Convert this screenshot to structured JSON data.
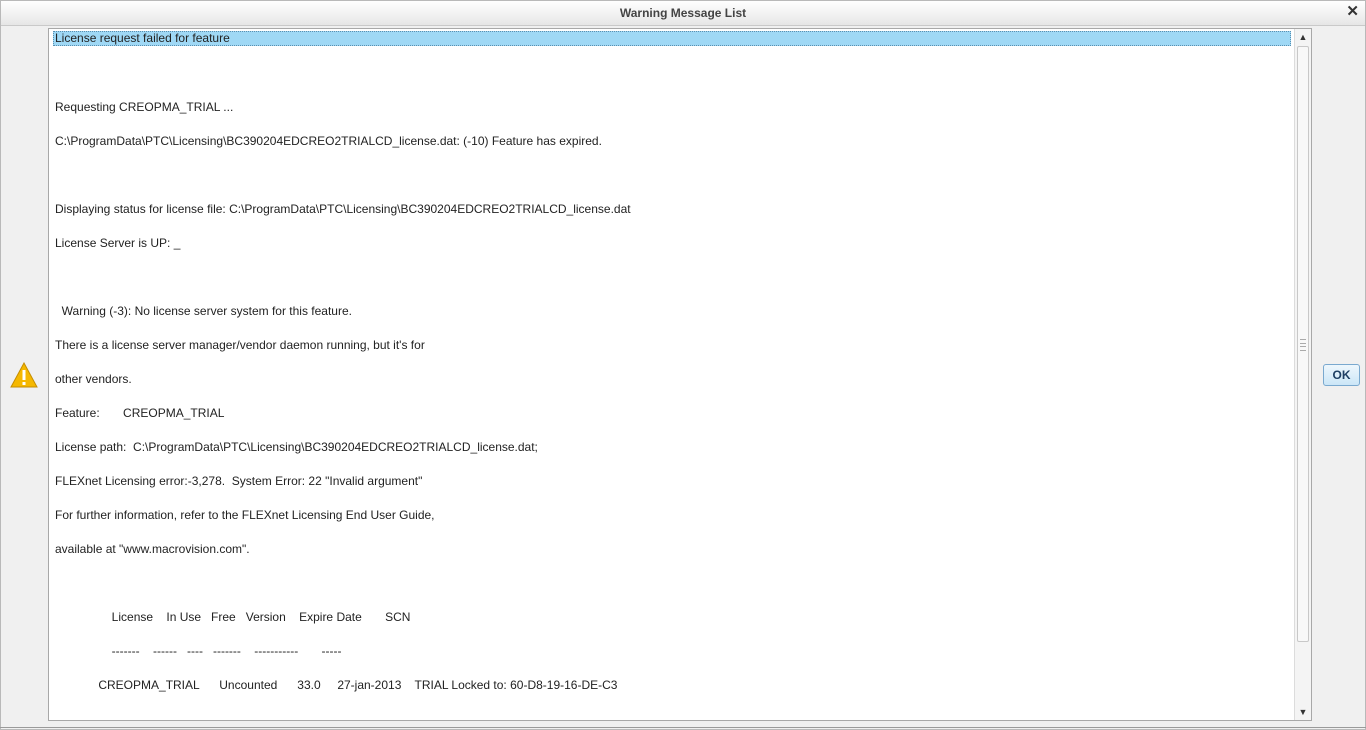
{
  "window": {
    "title": "Warning Message List",
    "close_glyph": "✕"
  },
  "icons": {
    "warning": "warning-triangle-icon",
    "close": "close-icon"
  },
  "colors": {
    "selection": "#9fd8f5",
    "warning_icon": "#f5b800",
    "ok_text": "#1e3f63"
  },
  "messages": [
    "License request failed for feature",
    "",
    "Requesting CREOPMA_TRIAL ...",
    "C:\\ProgramData\\PTC\\Licensing\\BC390204EDCREO2TRIALCD_license.dat: (-10) Feature has expired.",
    "",
    "Displaying status for license file: C:\\ProgramData\\PTC\\Licensing\\BC390204EDCREO2TRIALCD_license.dat",
    "License Server is UP: _",
    "",
    "  Warning (-3): No license server system for this feature.",
    "There is a license server manager/vendor daemon running, but it's for",
    "other vendors.",
    "Feature:       CREOPMA_TRIAL",
    "License path:  C:\\ProgramData\\PTC\\Licensing\\BC390204EDCREO2TRIALCD_license.dat;",
    "FLEXnet Licensing error:-3,278.  System Error: 22 \"Invalid argument\"",
    "For further information, refer to the FLEXnet Licensing End User Guide,",
    "available at \"www.macrovision.com\".",
    "",
    "                 License    In Use   Free   Version    Expire Date       SCN",
    "                 -------    ------   ----   -------    -----------       -----",
    "             CREOPMA_TRIAL      Uncounted      33.0     27-jan-2013    TRIAL Locked to: 60-D8-19-16-DE-C3"
  ],
  "scrollbar": {
    "up_glyph": "▲",
    "down_glyph": "▼"
  },
  "buttons": {
    "ok_label": "OK"
  }
}
